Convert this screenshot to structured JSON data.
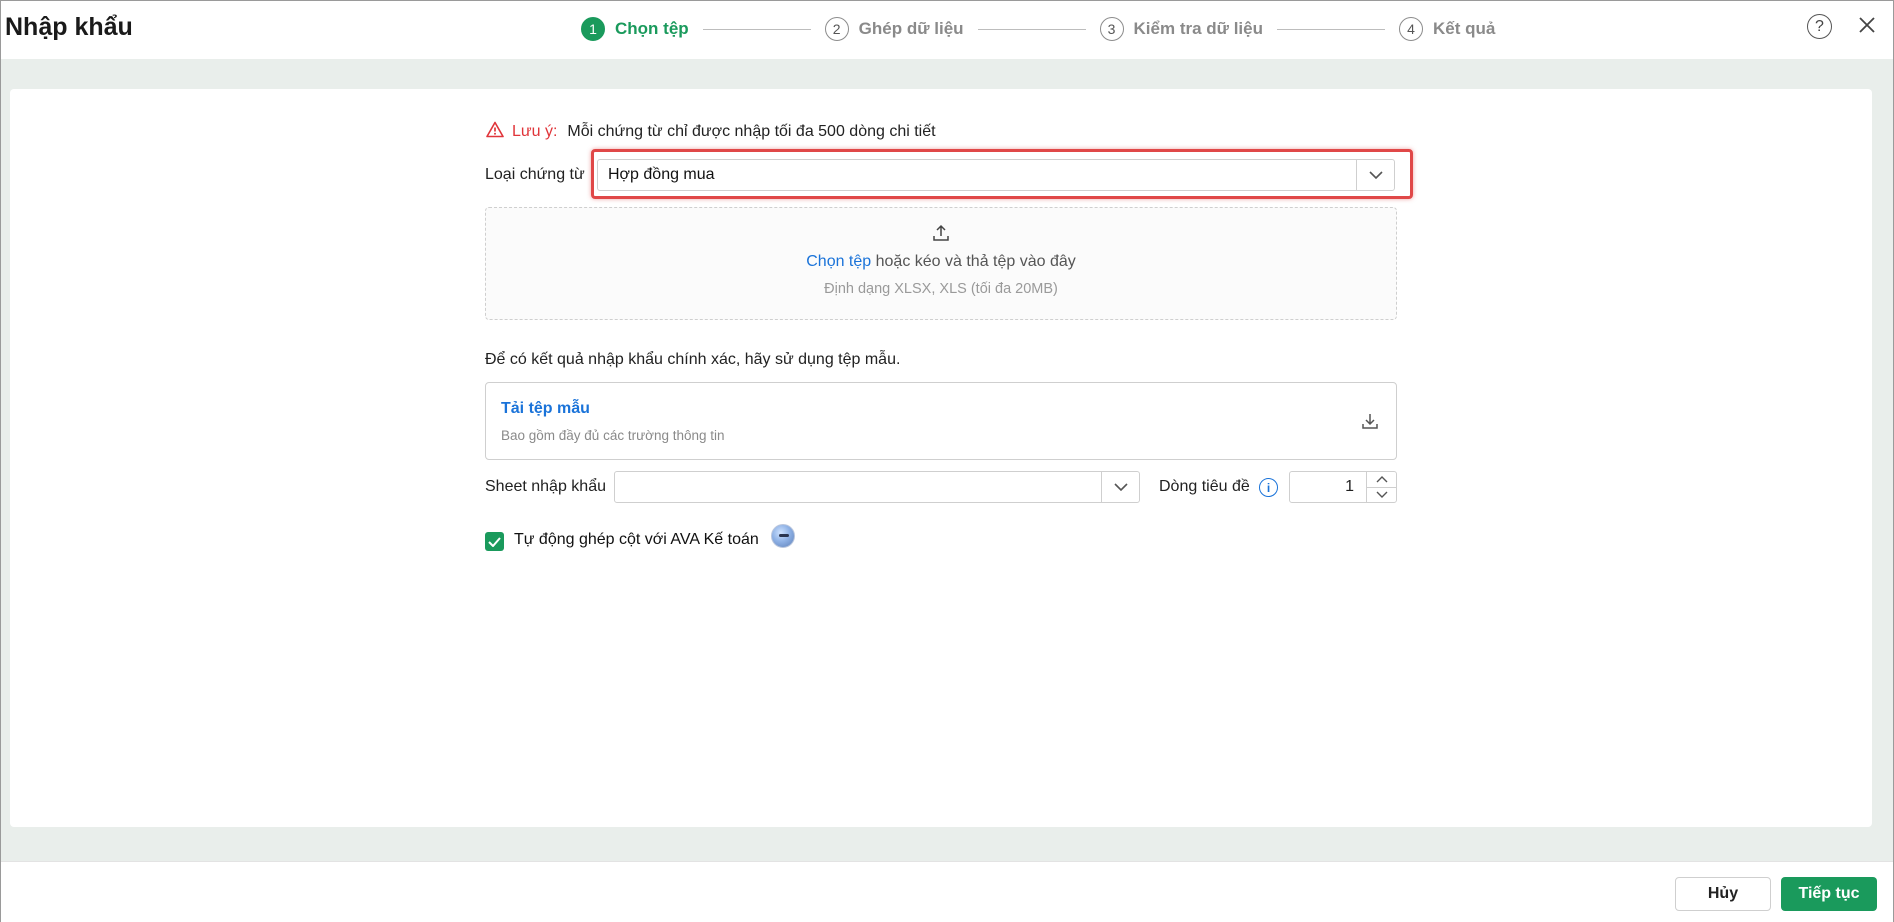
{
  "window": {
    "title": "Nhập khẩu"
  },
  "steps": [
    {
      "number": "1",
      "label": "Chọn tệp",
      "active": true
    },
    {
      "number": "2",
      "label": "Ghép dữ liệu",
      "active": false
    },
    {
      "number": "3",
      "label": "Kiểm tra dữ liệu",
      "active": false
    },
    {
      "number": "4",
      "label": "Kết quả",
      "active": false
    }
  ],
  "header": {
    "help_icon": "question-circle-icon",
    "help_glyph": "?",
    "close_icon": "close-icon"
  },
  "note": {
    "warning_label": "Lưu ý:",
    "text": "Mỗi chứng từ chỉ được nhập tối đa 500 dòng chi tiết"
  },
  "document_type": {
    "label": "Loại chứng từ",
    "value": "Hợp đồng mua"
  },
  "dropzone": {
    "link_text": "Chọn tệp",
    "text": " hoặc kéo và thả tệp vào đây",
    "formats": "Định dạng XLSX, XLS (tối đa 20MB)"
  },
  "template": {
    "tip": "Để có kết quả nhập khẩu chính xác, hãy sử dụng tệp mẫu.",
    "title": "Tải tệp mẫu",
    "subtitle": "Bao gồm đầy đủ các trường thông tin"
  },
  "sheet": {
    "label": "Sheet nhập khẩu",
    "value": ""
  },
  "header_row": {
    "label": "Dòng tiêu đề",
    "info_glyph": "i",
    "value": "1"
  },
  "auto_match": {
    "checked": true,
    "label": "Tự động ghép cột với AVA Kế toán"
  },
  "footer": {
    "cancel_label": "Hủy",
    "next_label": "Tiếp tục"
  },
  "colors": {
    "accent_green": "#1a9a5c",
    "link_blue": "#1a73d9",
    "warning_red": "#e0353a",
    "highlight_red": "#e04848",
    "background": "#e9eeeb"
  }
}
